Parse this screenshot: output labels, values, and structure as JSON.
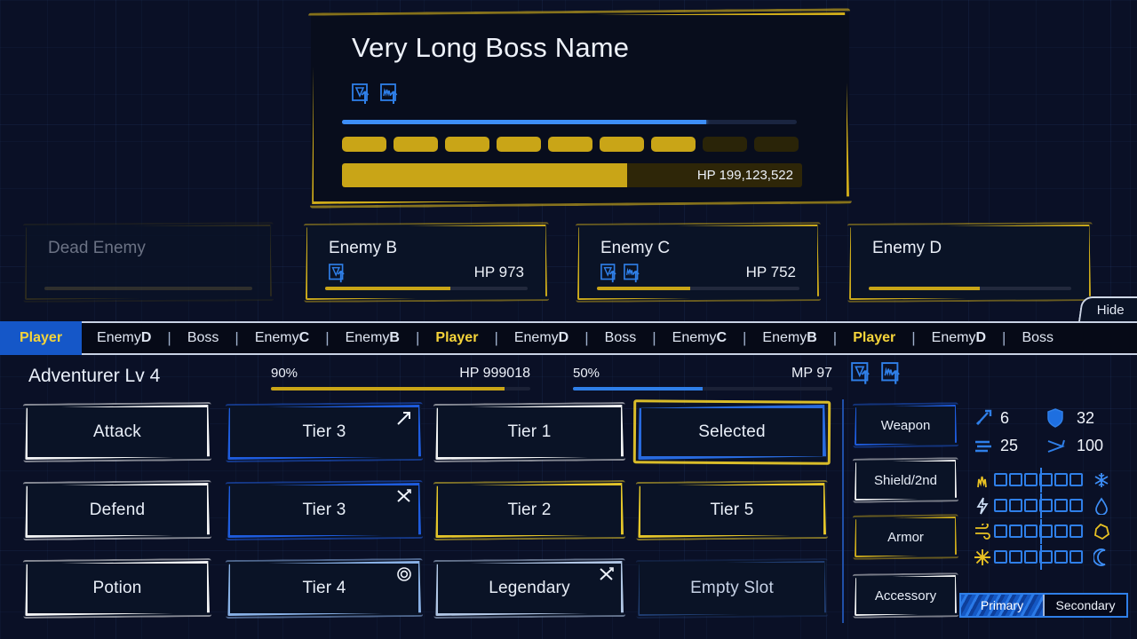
{
  "boss": {
    "name": "Very Long Boss Name",
    "status_icons": [
      "shield-up-icon",
      "flame-up-icon"
    ],
    "mp_percent": 80,
    "segments_total": 9,
    "segments_filled": 7,
    "hp_percent": 62,
    "hp_label": "HP 199,123,522",
    "border_color": "#d9b41a"
  },
  "enemies": [
    {
      "name": "Dead Enemy",
      "hp_label": "",
      "hp_percent": 0,
      "status_icons": [],
      "dead": true
    },
    {
      "name": "Enemy B",
      "hp_label": "HP 973",
      "hp_percent": 62,
      "status_icons": [
        "shield-up-icon"
      ],
      "dead": false
    },
    {
      "name": "Enemy C",
      "hp_label": "HP 752",
      "hp_percent": 46,
      "status_icons": [
        "shield-up-icon",
        "flame-up-icon"
      ],
      "dead": false
    },
    {
      "name": "Enemy D",
      "hp_label": "",
      "hp_percent": 55,
      "status_icons": [],
      "dead": false
    }
  ],
  "hide_button": {
    "label": "Hide"
  },
  "turn_order": [
    {
      "name": "Player",
      "state": "active"
    },
    {
      "name": "Enemy",
      "suffix": "D",
      "state": "normal"
    },
    {
      "name": "Boss",
      "state": "normal"
    },
    {
      "name": "Enemy",
      "suffix": "C",
      "state": "normal"
    },
    {
      "name": "Enemy",
      "suffix": "B",
      "state": "normal"
    },
    {
      "name": "Player",
      "state": "player"
    },
    {
      "name": "Enemy",
      "suffix": "D",
      "state": "normal"
    },
    {
      "name": "Boss",
      "state": "normal"
    },
    {
      "name": "Enemy",
      "suffix": "C",
      "state": "normal"
    },
    {
      "name": "Enemy",
      "suffix": "B",
      "state": "normal"
    },
    {
      "name": "Player",
      "state": "player"
    },
    {
      "name": "Enemy",
      "suffix": "D",
      "state": "normal"
    },
    {
      "name": "Boss",
      "state": "normal"
    }
  ],
  "player": {
    "name_level": "Adventurer Lv 4",
    "hp": {
      "percent_label": "90%",
      "percent": 90,
      "value_label": "HP 999018"
    },
    "mp": {
      "percent_label": "50%",
      "percent": 50,
      "value_label": "MP 97"
    },
    "status_icons": [
      "shield-up-icon",
      "flame-up-icon"
    ]
  },
  "actions": [
    {
      "label": "Attack",
      "style": "white",
      "icon": ""
    },
    {
      "label": "Defend",
      "style": "white",
      "icon": ""
    },
    {
      "label": "Potion",
      "style": "white",
      "icon": ""
    },
    {
      "label": "Tier 3",
      "style": "blue",
      "icon": "arrow-up-right-icon"
    },
    {
      "label": "Tier 3",
      "style": "blue",
      "icon": "crossed-swords-icon"
    },
    {
      "label": "Tier 4",
      "style": "lightblue",
      "icon": "spiral-target-icon"
    },
    {
      "label": "Tier 1",
      "style": "white",
      "icon": ""
    },
    {
      "label": "Tier 2",
      "style": "yellow",
      "icon": ""
    },
    {
      "label": "Legendary",
      "style": "legendary",
      "icon": "crossed-swords-icon"
    },
    {
      "label": "Selected",
      "style": "selected",
      "icon": ""
    },
    {
      "label": "Tier 5",
      "style": "yellow",
      "icon": ""
    },
    {
      "label": "Empty Slot",
      "style": "empty",
      "icon": ""
    }
  ],
  "equipment": [
    {
      "label": "Weapon",
      "style": "blue"
    },
    {
      "label": "Shield/2nd",
      "style": "white"
    },
    {
      "label": "Armor",
      "style": "yellow"
    },
    {
      "label": "Accessory",
      "style": "white"
    }
  ],
  "stats": [
    {
      "icon": "sword-stat-icon",
      "value": "6"
    },
    {
      "icon": "shield-stat-icon",
      "value": "32"
    },
    {
      "icon": "speed-stat-icon",
      "value": "25"
    },
    {
      "icon": "wing-stat-icon",
      "value": "100"
    }
  ],
  "elements": [
    {
      "left_icon": "fire-icon",
      "right_icon": "ice-icon",
      "cells": 6
    },
    {
      "left_icon": "lightning-icon",
      "right_icon": "water-icon",
      "cells": 6
    },
    {
      "left_icon": "wind-icon",
      "right_icon": "earth-icon",
      "cells": 6
    },
    {
      "left_icon": "light-icon",
      "right_icon": "dark-icon",
      "cells": 6
    }
  ],
  "loadout_tabs": [
    {
      "label": "Primary",
      "selected": true
    },
    {
      "label": "Secondary",
      "selected": false
    }
  ],
  "colors": {
    "background": "#0a1026",
    "gold": "#d9b41a",
    "blue": "#2f7fe8",
    "white": "#ffffff",
    "active_turn_bg": "#1557c8",
    "active_turn_text": "#f5d43a"
  }
}
